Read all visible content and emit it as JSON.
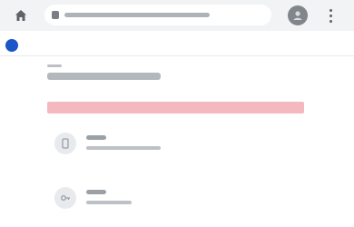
{
  "browser": {
    "url": "",
    "icons": {
      "home": "home-icon",
      "lock": "lock-icon",
      "account": "account-circle-icon",
      "menu": "more-vert-icon"
    }
  },
  "header": {
    "logo_text": ""
  },
  "main": {
    "section_label": "",
    "account_email": "",
    "alert_text": "",
    "options": [
      {
        "title": "",
        "subtitle": "",
        "icon": "phone-icon"
      },
      {
        "title": "",
        "subtitle": "",
        "icon": "key-icon"
      }
    ]
  },
  "colors": {
    "brand": "#1a56c8",
    "alert_background": "#f3b9bf",
    "browser_chrome": "#f1f3f4"
  }
}
